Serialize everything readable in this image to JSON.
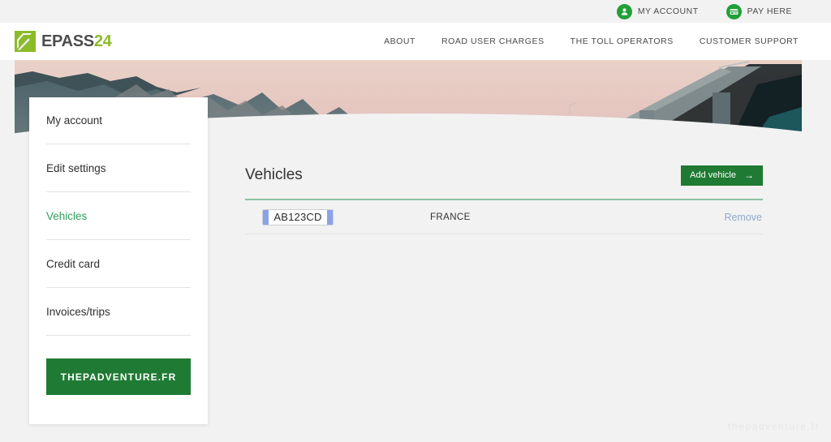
{
  "utility_bar": {
    "links": [
      {
        "label": "MY ACCOUNT",
        "icon": "user-icon"
      },
      {
        "label": "PAY HERE",
        "icon": "payment-card-icon"
      }
    ]
  },
  "header": {
    "logo": {
      "text_dark": "EPASS",
      "text_accent": "24",
      "icon": "epass24-logo-mark"
    },
    "nav": [
      {
        "label": "ABOUT"
      },
      {
        "label": "ROAD USER CHARGES"
      },
      {
        "label": "THE TOLL OPERATORS"
      },
      {
        "label": "CUSTOMER SUPPORT"
      }
    ]
  },
  "hero": {
    "alt": "bridge-over-water-at-dusk-with-mountains"
  },
  "sidebar": {
    "items": [
      {
        "label": "My account",
        "active": false
      },
      {
        "label": "Edit settings",
        "active": false
      },
      {
        "label": "Vehicles",
        "active": true
      },
      {
        "label": "Credit card",
        "active": false
      },
      {
        "label": "Invoices/trips",
        "active": false
      }
    ],
    "cta_label": "THEPADVENTURE.FR"
  },
  "main": {
    "title": "Vehicles",
    "add_button": {
      "label": "Add vehicle",
      "arrow": "→"
    },
    "vehicles": [
      {
        "plate": "AB123CD",
        "country": "FRANCE",
        "remove_label": "Remove"
      }
    ]
  },
  "watermark": {
    "text": "thepadventure.fr"
  },
  "colors": {
    "brand_green": "#8bbb28",
    "action_green": "#1f7a33",
    "accent_green": "#21a038",
    "active_item_green": "#2f9e5e",
    "link_blue": "#8fa9c9",
    "plate_blue": "#8ba3e8",
    "page_bg": "#f2f2f2"
  }
}
